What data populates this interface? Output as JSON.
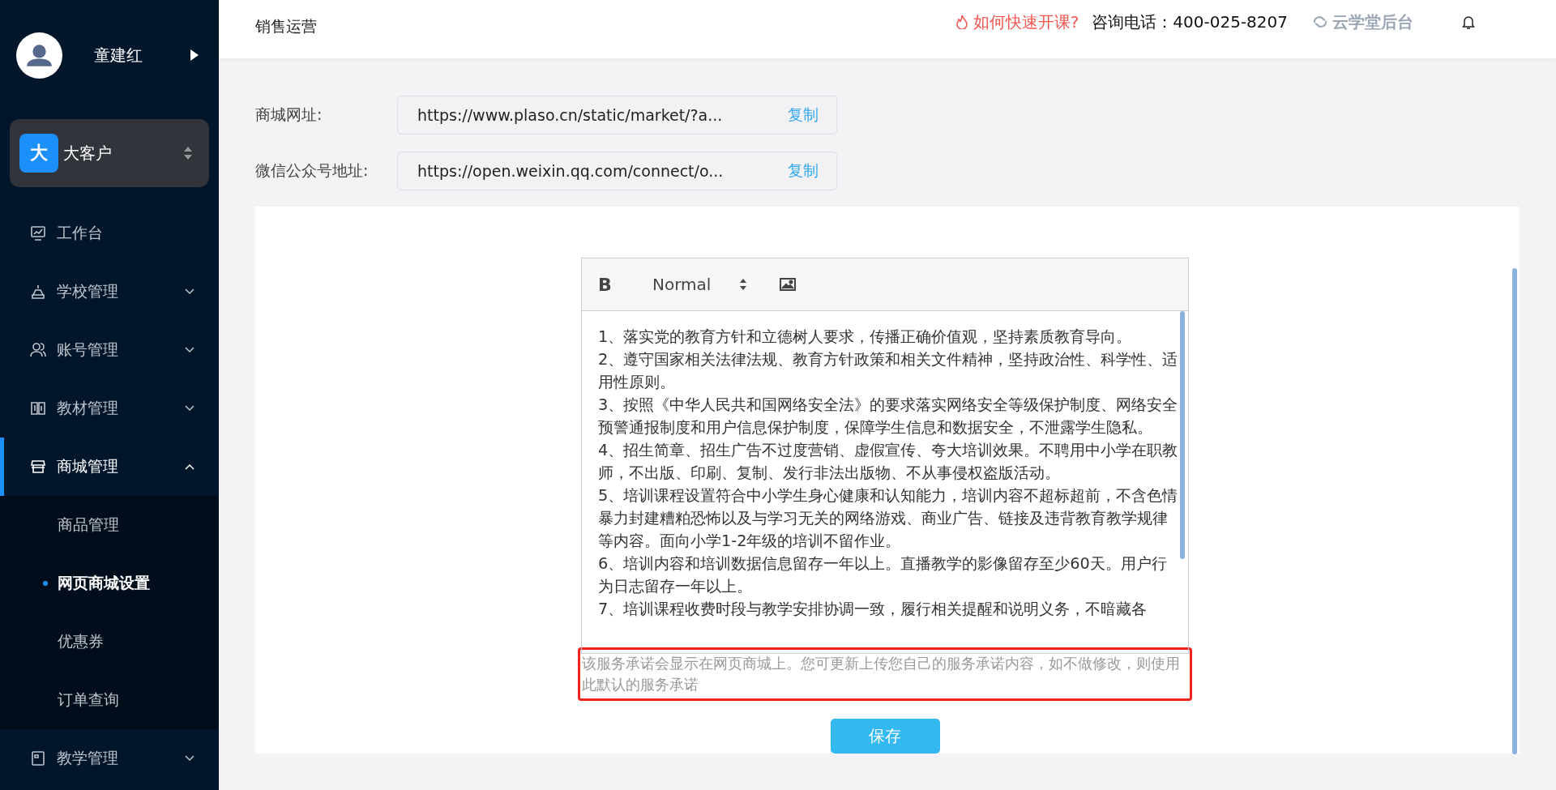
{
  "sidebar": {
    "user": {
      "name": "童建红"
    },
    "account": {
      "badge": "大",
      "name": "大客户"
    },
    "menu": [
      {
        "label": "工作台",
        "selected": false
      },
      {
        "label": "学校管理",
        "expanded": false,
        "selected": false
      },
      {
        "label": "账号管理",
        "expanded": false,
        "selected": false
      },
      {
        "label": "教材管理",
        "expanded": false,
        "selected": false
      },
      {
        "label": "商城管理",
        "expanded": true,
        "selected": true,
        "children": [
          {
            "label": "商品管理",
            "selected": false
          },
          {
            "label": "网页商城设置",
            "selected": true
          },
          {
            "label": "优惠券",
            "selected": false
          },
          {
            "label": "订单查询",
            "selected": false
          }
        ]
      },
      {
        "label": "教学管理",
        "expanded": false,
        "selected": false
      }
    ]
  },
  "header": {
    "title": "销售运营",
    "help_link": "如何快速开课?",
    "phone": "咨询电话：400-025-8207",
    "brand": "云学堂后台"
  },
  "fields": [
    {
      "label": "商城网址:",
      "value": "https://www.plaso.cn/static/market/?a...",
      "action": "复制"
    },
    {
      "label": "微信公众号地址:",
      "value": "https://open.weixin.qq.com/connect/o...",
      "action": "复制"
    }
  ],
  "editor": {
    "toolbar": {
      "bold": "B",
      "format": "Normal"
    },
    "paragraphs": [
      "1、落实党的教育方针和立德树人要求，传播正确价值观，坚持素质教育导向。",
      "2、遵守国家相关法律法规、教育方针政策和相关文件精神，坚持政治性、科学性、适用性原则。",
      "3、按照《中华人民共和国网络安全法》的要求落实网络安全等级保护制度、网络安全预警通报制度和用户信息保护制度，保障学生信息和数据安全，不泄露学生隐私。",
      "4、招生简章、招生广告不过度营销、虚假宣传、夸大培训效果。不聘用中小学在职教师，不出版、印刷、复制、发行非法出版物、不从事侵权盗版活动。",
      "5、培训课程设置符合中小学生身心健康和认知能力，培训内容不超标超前，不含色情暴力封建糟粕恐怖以及与学习无关的网络游戏、商业广告、链接及违背教育教学规律等内容。面向小学1-2年级的培训不留作业。",
      "6、培训内容和培训数据信息留存一年以上。直播教学的影像留存至少60天。用户行为日志留存一年以上。",
      "7、培训课程收费时段与教学安排协调一致，履行相关提醒和说明义务，不暗藏各"
    ],
    "hint": "该服务承诺会显示在网页商城上。您可更新上传您自己的服务承诺内容，如不做修改，则使用此默认的服务承诺"
  },
  "save_button": "保存"
}
